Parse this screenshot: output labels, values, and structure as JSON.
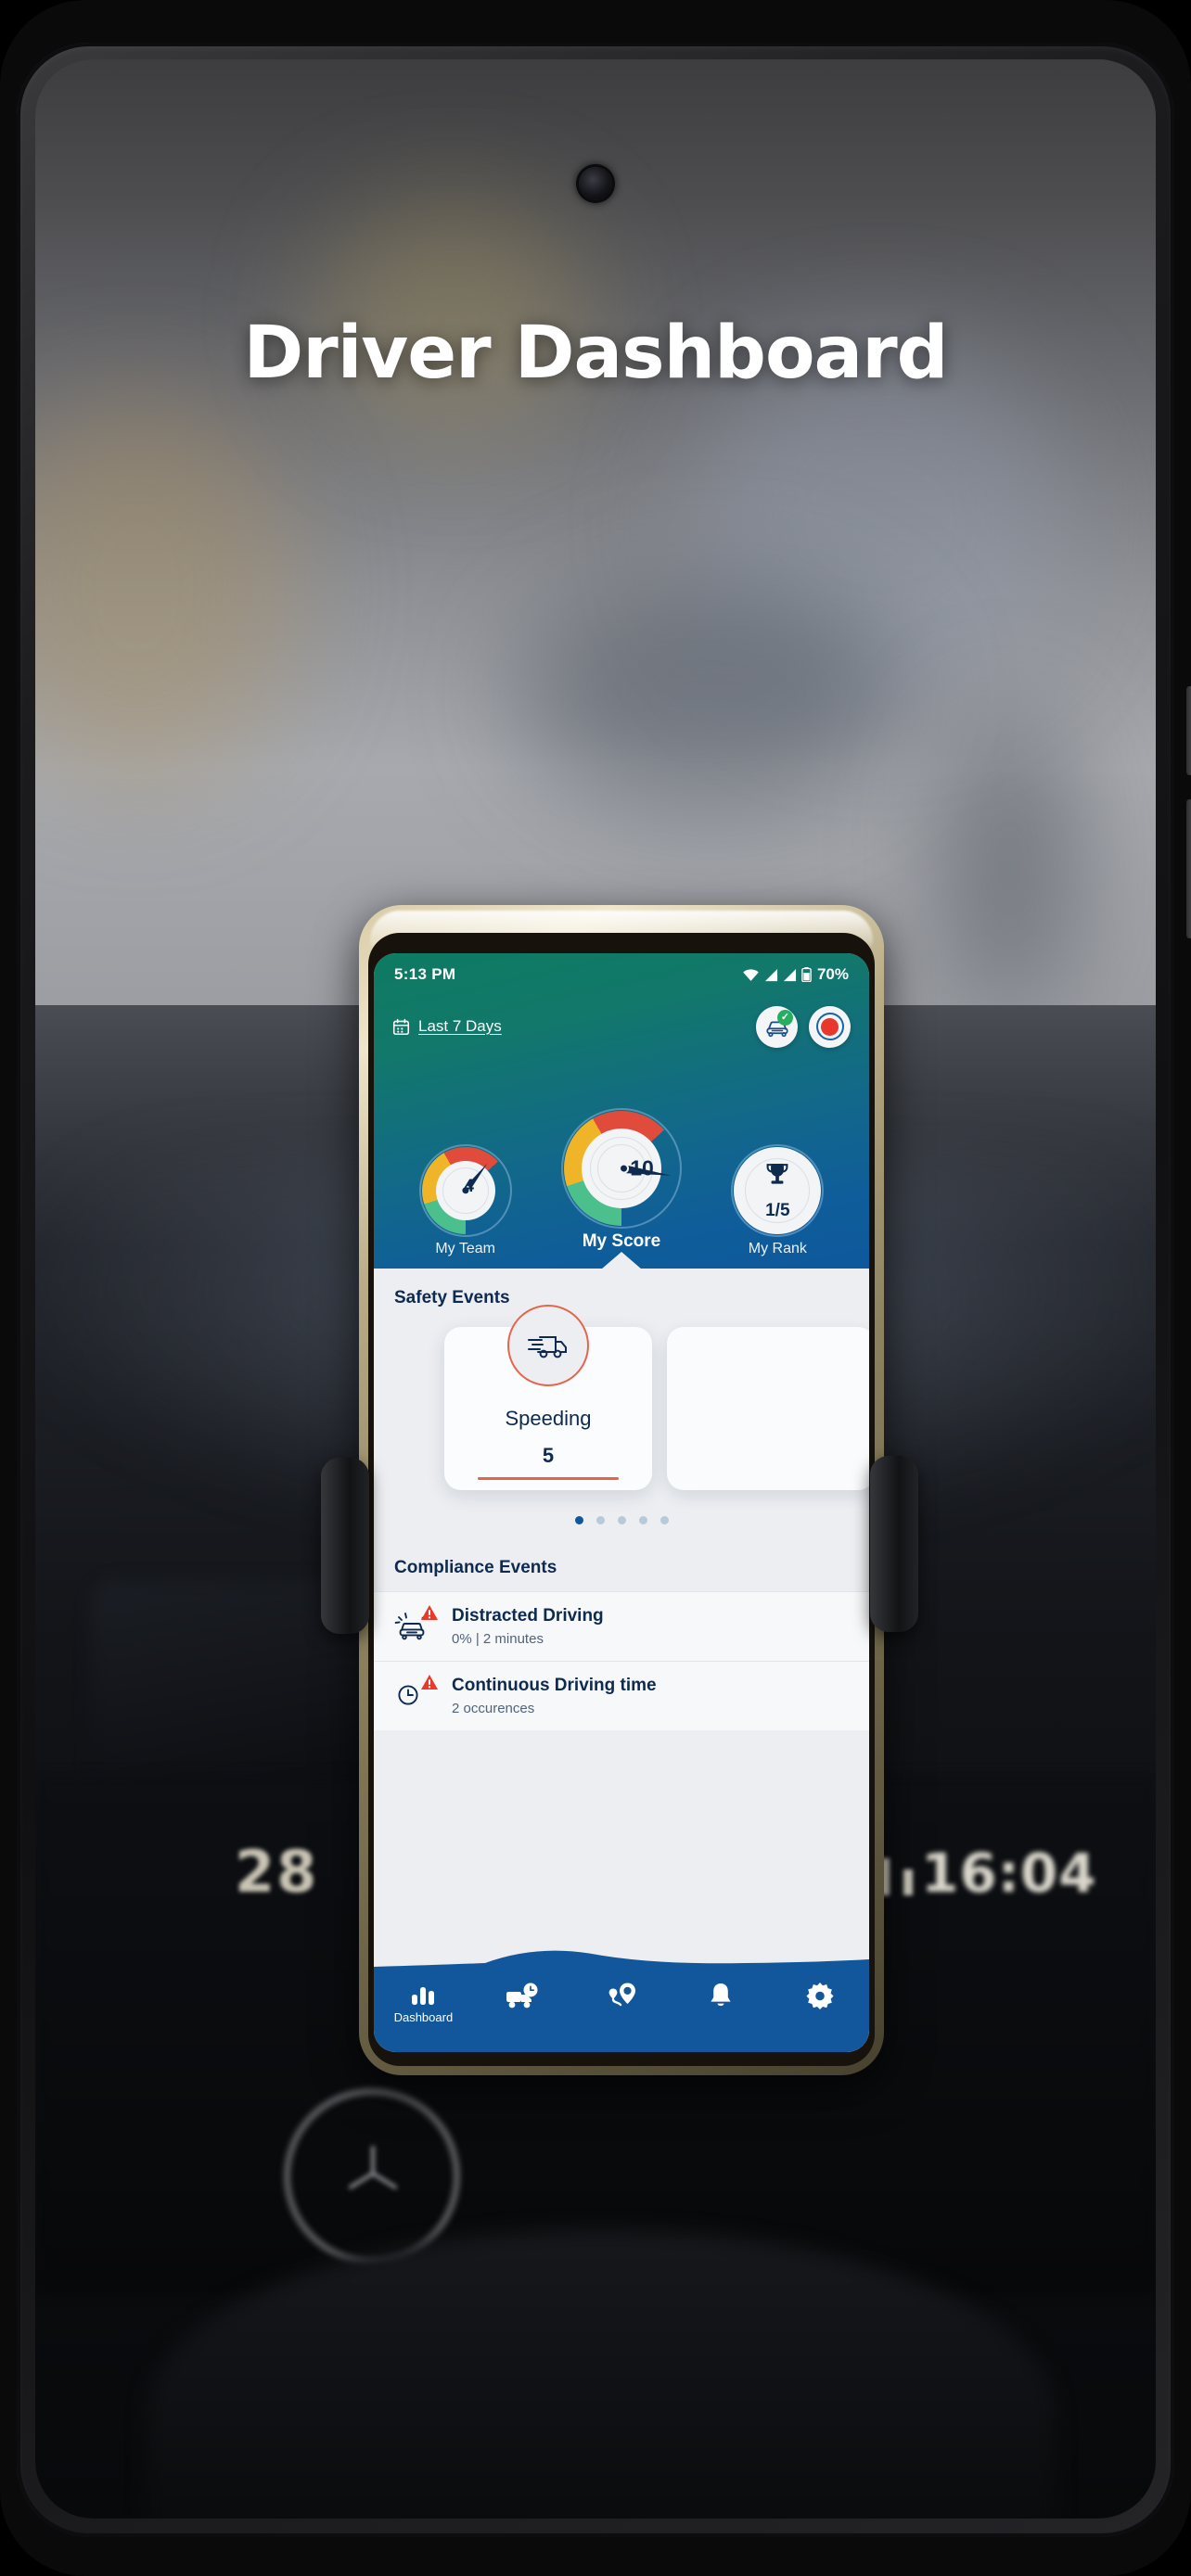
{
  "page": {
    "title": "Driver Dashboard"
  },
  "background": {
    "dash_number": "28",
    "dash_clock": "16:04"
  },
  "phone": {
    "status_bar": {
      "time": "5:13 PM",
      "wifi_icon": "wifi-icon",
      "signal_icon_1": "signal-bars-icon",
      "signal_icon_2": "signal-bars-icon",
      "battery_icon": "battery-icon",
      "battery_level": "70%"
    },
    "header": {
      "calendar_icon": "calendar-icon",
      "date_range_label": "Last 7 Days",
      "vehicle_check_icon": "vehicle-check-icon",
      "vehicle_check_badge": "✓",
      "record_icon": "record-icon",
      "gauges": [
        {
          "id": "my-team",
          "caption": "My Team",
          "value": "4",
          "emphasis": false
        },
        {
          "id": "my-score",
          "caption": "My Score",
          "value": "10",
          "emphasis": true
        },
        {
          "id": "my-rank",
          "caption": "My Rank",
          "value": "1/5",
          "icon": "trophy-icon",
          "emphasis": false
        }
      ]
    },
    "safety": {
      "section_title": "Safety Events",
      "cards": [
        {
          "icon": "speeding-truck-icon",
          "label": "Speeding",
          "value": "5"
        },
        {
          "icon": "",
          "label": "",
          "value": ""
        }
      ],
      "dots_total": 5,
      "dots_active_index": 0
    },
    "compliance": {
      "section_title": "Compliance Events",
      "rows": [
        {
          "icon": "distracted-driving-icon",
          "warning_icon": "warning-triangle-icon",
          "title": "Distracted Driving",
          "subtitle": "0% | 2 minutes"
        },
        {
          "icon": "driving-time-clock-icon",
          "warning_icon": "warning-triangle-icon",
          "title": "Continuous Driving time",
          "subtitle": "2 occurences"
        }
      ]
    },
    "bottom_nav": [
      {
        "icon": "bar-chart-icon",
        "label": "Dashboard",
        "active": true
      },
      {
        "icon": "truck-clock-icon",
        "label": "",
        "active": false
      },
      {
        "icon": "route-location-icon",
        "label": "",
        "active": false
      },
      {
        "icon": "bell-icon",
        "label": "",
        "active": false
      },
      {
        "icon": "gear-icon",
        "label": "",
        "active": false
      }
    ]
  },
  "colors": {
    "header_green": "#0e7b62",
    "header_blue": "#0e589c",
    "nav_blue": "#12569b",
    "accent_orange": "#e4654b",
    "navy_text": "#0e2a4f",
    "gauge_green": "#4bbf8c",
    "gauge_amber": "#f0b429",
    "gauge_red": "#e14b3c",
    "record_red": "#e8372c",
    "check_green": "#27ae60"
  }
}
